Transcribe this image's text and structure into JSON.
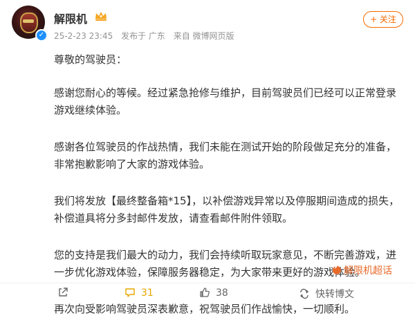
{
  "post": {
    "author": "解限机",
    "date": "25-2-23 23:45",
    "published_label": "发布于 广东",
    "source": "来自 微博网页版",
    "follow_label": "+ 关注"
  },
  "content": {
    "greeting": "尊敬的驾驶员：",
    "p1": "感谢您耐心的等候。经过紧急抢修与维护，目前驾驶员们已经可以正常登录游戏继续体验。",
    "p2": "感谢各位驾驶员的作战热情，我们未能在测试开始的阶段做足充分的准备，非常抱歉影响了大家的游戏体验。",
    "p3": "我们将发放【最终整备箱*15】，以补偿游戏异常以及停服期间造成的损失，补偿道具将分多封邮件发放，请查看邮件附件领取。",
    "p4": "您的支持是我们最大的动力，我们会持续听取玩家意见，不断完善游戏，进一步优化游戏体验，保障服务器稳定，为大家带来更好的游戏体验。",
    "p5": "再次向受影响驾驶员深表歉意，祝驾驶员们作战愉快，一切顺利。",
    "topic_link": "解限机超话"
  },
  "actions": {
    "comment_count": "31",
    "like_count": "38",
    "quick_share": "快转博文"
  },
  "colors": {
    "accent": "#f56a00",
    "meta_text": "#939393",
    "body_text": "#333333",
    "comment_icon": "#e6a600",
    "topic_link": "#e86a2a"
  },
  "icons": [
    "verified-badge-icon",
    "vip-crown-icon",
    "share-icon",
    "comment-icon",
    "like-icon",
    "quick-share-icon",
    "topic-icon"
  ]
}
